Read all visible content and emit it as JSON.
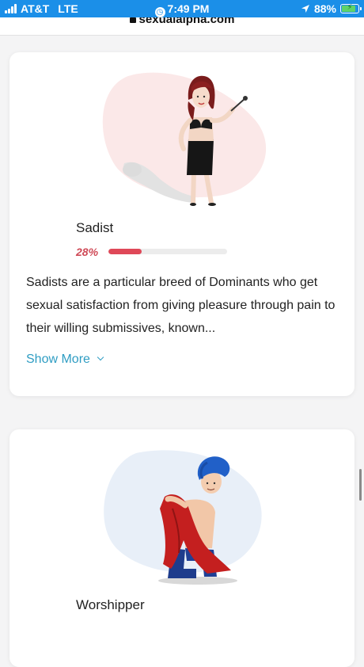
{
  "status_bar": {
    "carrier": "AT&T",
    "network": "LTE",
    "time": "7:49 PM",
    "battery": "88%",
    "battery_level": 0.88
  },
  "browser": {
    "url": "sexualalpha.com"
  },
  "cards": [
    {
      "name": "Sadist",
      "percent_label": "28%",
      "percent_value": 0.28,
      "description": "Sadists are a particular breed of Dominants who get sexual satisfaction from giving pleasure through pain to their willing submissives, known...",
      "show_more": "Show More"
    },
    {
      "name": "Worshipper"
    }
  ],
  "colors": {
    "status_bar": "#1b8fe8",
    "accent_red": "#df4858",
    "link_blue": "#2f9dc3"
  }
}
